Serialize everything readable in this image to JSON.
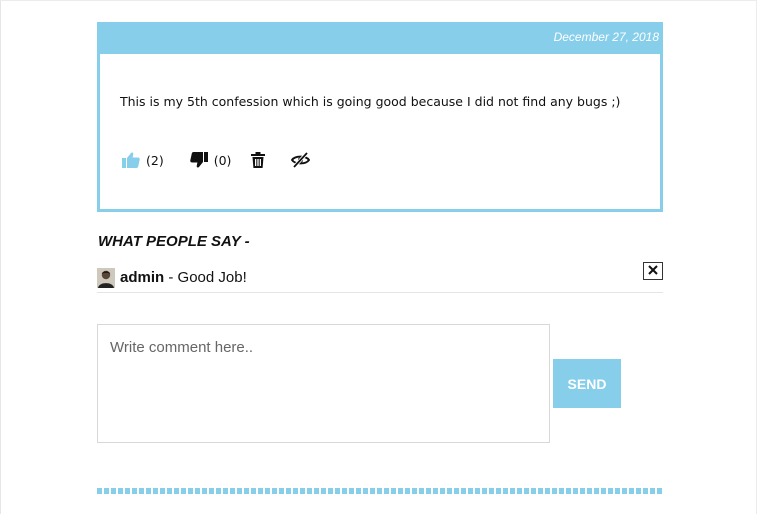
{
  "post": {
    "date": "December 27, 2018",
    "body": "This is my 5th confession which is going good because I did not find any bugs ;)",
    "likes": "(2)",
    "dislikes": "(0)",
    "icons": {
      "like": "thumbs-up-icon",
      "dislike": "thumbs-down-icon",
      "delete": "trash-icon",
      "hide": "eye-slash-icon"
    }
  },
  "comments_section": {
    "title": "WHAT PEOPLE SAY -",
    "items": [
      {
        "author": "admin",
        "separator": " - ",
        "text": "Good Job!"
      }
    ]
  },
  "comment_form": {
    "placeholder": "Write comment here..",
    "value": "",
    "send_label": "SEND"
  },
  "colors": {
    "accent": "#87ceeb",
    "text": "#111111"
  }
}
